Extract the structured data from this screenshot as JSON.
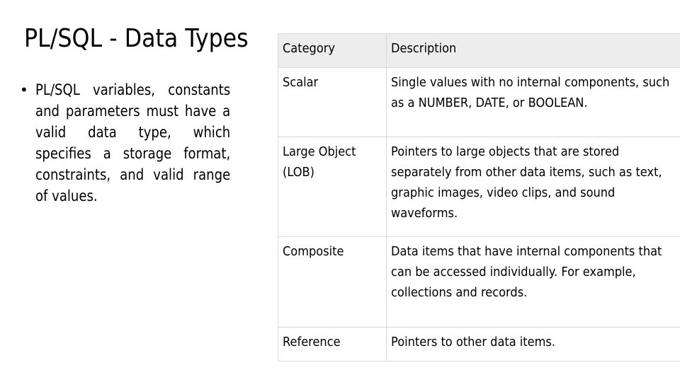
{
  "slide": {
    "title": "PL/SQL - Data Types",
    "bullets": [
      "PL/SQL variables, constants and parameters must have a valid data type, which specifies a storage format, constraints, and valid range of values."
    ],
    "bullet_glyph": "•"
  },
  "table": {
    "headers": [
      "Category",
      "Description"
    ],
    "rows": [
      {
        "category": "Scalar",
        "description": "Single values with no internal components, such as a NUMBER, DATE, or BOOLEAN."
      },
      {
        "category": "Large Object (LOB)",
        "description": "Pointers to large objects that are stored separately from other data items, such as text, graphic images, video clips, and sound waveforms."
      },
      {
        "category": "Composite",
        "description": "Data items that have internal components that can be accessed individually. For example, collections and records."
      },
      {
        "category": "Reference",
        "description": "Pointers to other data items."
      }
    ],
    "colors": {
      "header_bg": "#ededed",
      "border": "#d9d9d9"
    }
  }
}
